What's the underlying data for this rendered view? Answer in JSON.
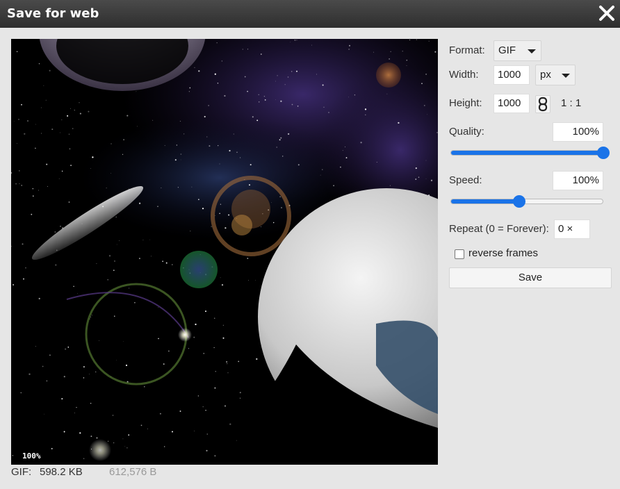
{
  "dialog": {
    "title": "Save for web",
    "close_icon": "close-icon"
  },
  "preview": {
    "zoom": "100%"
  },
  "footer": {
    "format": "GIF:",
    "size_kb": "598.2 KB",
    "size_bytes": "612,576 B"
  },
  "panel": {
    "format_label": "Format:",
    "format_value": "GIF",
    "width_label": "Width:",
    "width_value": "1000",
    "unit_value": "px",
    "height_label": "Height:",
    "height_value": "1000",
    "link_icon": "chain-link-icon",
    "ratio": "1 : 1",
    "quality_label": "Quality:",
    "quality_value": "100%",
    "quality_fraction": 1.0,
    "speed_label": "Speed:",
    "speed_value": "100%",
    "speed_fraction": 0.45,
    "repeat_label": "Repeat (0 = Forever):",
    "repeat_value": "0 ×",
    "reverse_label": "reverse frames",
    "reverse_checked": false,
    "save_label": "Save"
  },
  "colors": {
    "accent": "#1a73e8",
    "titlebar": "#3a3a3a",
    "background": "#e6e6e6"
  }
}
